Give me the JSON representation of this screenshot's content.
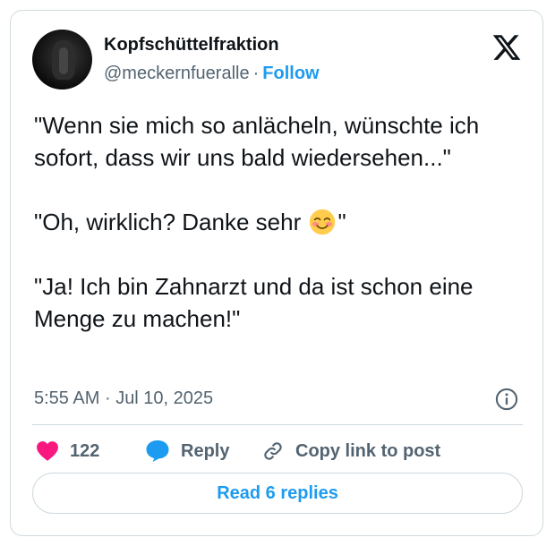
{
  "author": {
    "name": "Kopfschüttelfraktion",
    "handle": "@meckernfueralle",
    "separator": "·",
    "follow_label": "Follow"
  },
  "tweet": {
    "line1": "\"Wenn sie mich so anlächeln, wünschte ich sofort, dass wir uns bald wiedersehen...\"",
    "line2_before": "\"Oh, wirklich? Danke sehr ",
    "line2_emoji": "smiling-face-with-blush-emoji",
    "line2_after": "\"",
    "line3": "\"Ja! Ich bin Zahnarzt und da ist schon eine Menge zu machen!\""
  },
  "meta": {
    "time": "5:55 AM",
    "separator": "·",
    "date": "Jul 10, 2025"
  },
  "actions": {
    "like_count": "122",
    "reply_label": "Reply",
    "copy_label": "Copy link to post"
  },
  "read_replies_label": "Read 6 replies",
  "colors": {
    "accent": "#1d9bf0",
    "like": "#f91880",
    "text": "#0f1419",
    "secondary": "#536471",
    "border": "#cfd9de"
  }
}
